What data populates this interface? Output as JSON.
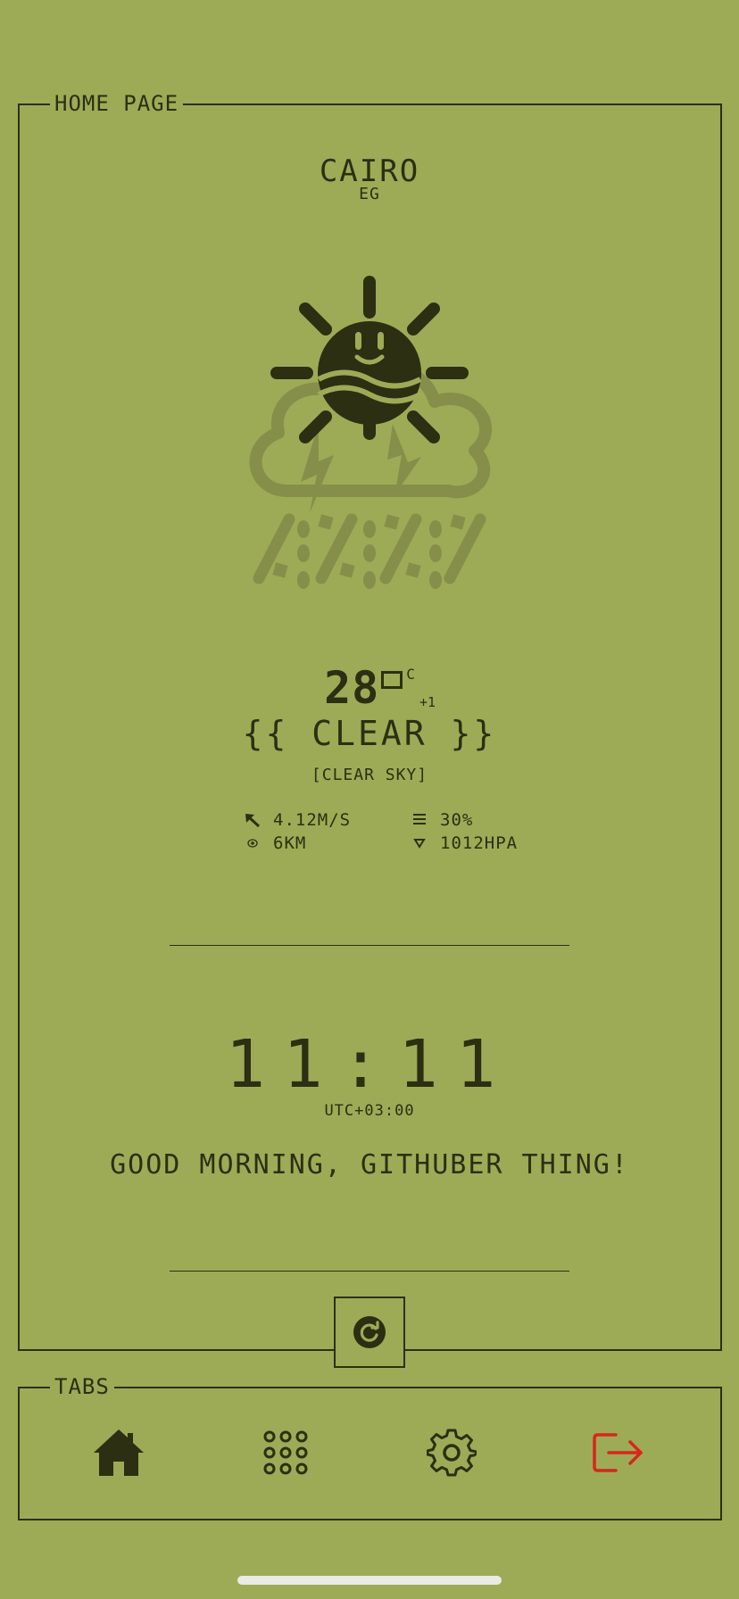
{
  "home_page": {
    "legend": "HOME PAGE"
  },
  "location": {
    "city": "CAIRO",
    "country": "EG"
  },
  "weather": {
    "icon": "sun-cloud-storm-icon",
    "temperature": "28",
    "unit": "C",
    "feels_delta": "+1",
    "condition": "{{ CLEAR }}",
    "description": "[CLEAR SKY]",
    "wind": "4.12M/S",
    "humidity": "30%",
    "visibility": "6KM",
    "pressure": "1012HPA"
  },
  "clock": {
    "time": "11:11",
    "timezone": "UTC+03:00"
  },
  "greeting": "GOOD MORNING, GITHUBER THING!",
  "tabs": {
    "legend": "TABS",
    "items": [
      {
        "icon": "home-icon"
      },
      {
        "icon": "apps-grid-icon"
      },
      {
        "icon": "gear-icon"
      },
      {
        "icon": "logout-icon"
      }
    ]
  },
  "colors": {
    "background": "#9dab56",
    "ink": "#2c2f12",
    "faded": "#858f4a",
    "logout": "#d8261c"
  }
}
